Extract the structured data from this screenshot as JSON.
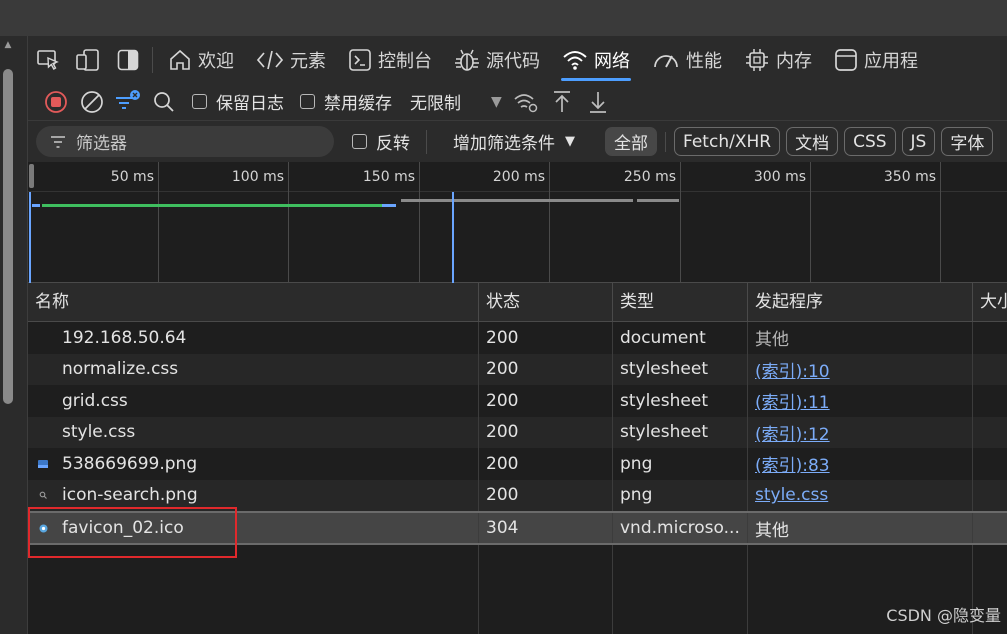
{
  "tabs": [
    {
      "label": "欢迎",
      "icon": "home-icon"
    },
    {
      "label": "元素",
      "icon": "code-brackets-icon"
    },
    {
      "label": "控制台",
      "icon": "console-icon"
    },
    {
      "label": "源代码",
      "icon": "bug-icon"
    },
    {
      "label": "网络",
      "icon": "wifi-icon",
      "active": true
    },
    {
      "label": "性能",
      "icon": "gauge-icon"
    },
    {
      "label": "内存",
      "icon": "chip-icon"
    },
    {
      "label": "应用程",
      "icon": "window-icon"
    }
  ],
  "toolbar": {
    "preserve_log": "保留日志",
    "disable_cache": "禁用缓存",
    "throttle": "无限制"
  },
  "filter": {
    "placeholder": "筛选器",
    "invert": "反转",
    "more_filters": "增加筛选条件",
    "types": [
      "全部",
      "Fetch/XHR",
      "文档",
      "CSS",
      "JS",
      "字体"
    ]
  },
  "timeline": {
    "ticks": [
      "50 ms",
      "100 ms",
      "150 ms",
      "200 ms",
      "250 ms",
      "300 ms",
      "350 ms"
    ]
  },
  "table": {
    "headers": [
      "名称",
      "状态",
      "类型",
      "发起程序",
      "大小"
    ],
    "rows": [
      {
        "name": "192.168.50.64",
        "status": "200",
        "type": "document",
        "initiator": "其他",
        "initiator_link": false
      },
      {
        "name": "normalize.css",
        "status": "200",
        "type": "stylesheet",
        "initiator": "(索引):10",
        "initiator_link": true
      },
      {
        "name": "grid.css",
        "status": "200",
        "type": "stylesheet",
        "initiator": "(索引):11",
        "initiator_link": true
      },
      {
        "name": "style.css",
        "status": "200",
        "type": "stylesheet",
        "initiator": "(索引):12",
        "initiator_link": true
      },
      {
        "name": "538669699.png",
        "status": "200",
        "type": "png",
        "initiator": "(索引):83",
        "initiator_link": true,
        "icon": "image-icon"
      },
      {
        "name": "icon-search.png",
        "status": "200",
        "type": "png",
        "initiator": "style.css",
        "initiator_link": true,
        "icon": "search-small-icon"
      },
      {
        "name": "favicon_02.ico",
        "status": "304",
        "type": "vnd.microso...",
        "initiator": "其他",
        "initiator_link": false,
        "icon": "favicon-icon",
        "selected": true
      }
    ]
  },
  "watermark": "CSDN @隐变量",
  "colors": {
    "accent": "#4d9eff",
    "link": "#7cacf8",
    "record_stop": "#e25a5a",
    "highlight_box": "#e0292c"
  }
}
